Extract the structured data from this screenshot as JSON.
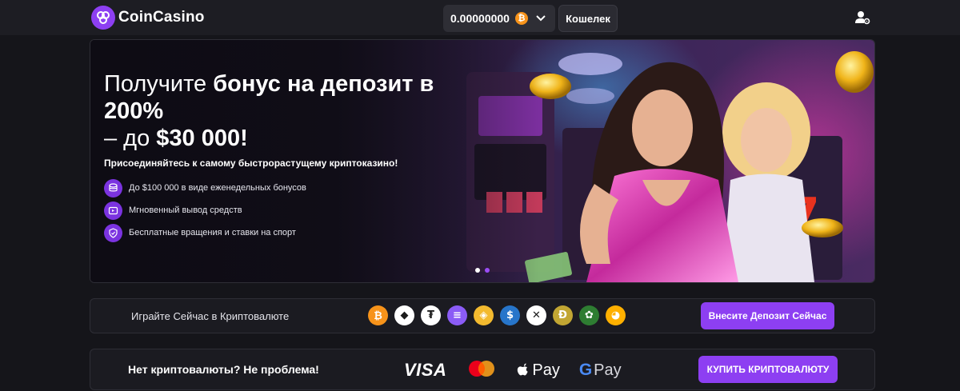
{
  "header": {
    "brand": "CoinCasino",
    "balance": "0.00000000",
    "currency_symbol": "₿",
    "wallet_label": "Кошелек"
  },
  "hero": {
    "title_plain_1": "Получите ",
    "title_bold_1": "бонус на депозит в 200%",
    "title_plain_2": "– до ",
    "title_bold_2": "$30 000!",
    "subtitle": "Присоединяйтесь к самому быстрорастущему криптоказино!",
    "features": [
      {
        "icon": "coins-icon",
        "text": "До $100 000 в виде еженедельных бонусов"
      },
      {
        "icon": "instant-withdraw-icon",
        "text": "Мгновенный вывод средств"
      },
      {
        "icon": "shield-icon",
        "text": "Бесплатные вращения и ставки на спорт"
      }
    ],
    "slides_total": 2,
    "slide_active": 2
  },
  "crypto_strip": {
    "label": "Играйте Сейчас в Криптовалюте",
    "coins": [
      {
        "name": "bitcoin-icon",
        "glyph": "₿",
        "color": "#f7931a"
      },
      {
        "name": "ethereum-icon",
        "glyph": "◆",
        "color": "#ffffff"
      },
      {
        "name": "tether-icon",
        "glyph": "₮",
        "color": "#ffffff"
      },
      {
        "name": "solana-icon",
        "glyph": "≡",
        "color": "#8b5cf6"
      },
      {
        "name": "bnb-icon",
        "glyph": "◈",
        "color": "#f3ba2f"
      },
      {
        "name": "usdc-icon",
        "glyph": "$",
        "color": "#2775ca"
      },
      {
        "name": "xrp-icon",
        "glyph": "✕",
        "color": "#ffffff"
      },
      {
        "name": "dogecoin-icon",
        "glyph": "Ð",
        "color": "#c2a633"
      },
      {
        "name": "rose-token-icon",
        "glyph": "✿",
        "color": "#2e7d32"
      },
      {
        "name": "shiba-inu-icon",
        "glyph": "◕",
        "color": "#ffb000"
      }
    ],
    "button_label": "Внесите Депозит Сейчас"
  },
  "buy_strip": {
    "label": "Нет криптовалюты? Не проблема!",
    "visa": "VISA",
    "apple_pay": "Pay",
    "google_g": "G",
    "google_pay": "Pay",
    "button_label": "КУПИТЬ КРИПТОВАЛЮТУ"
  },
  "colors": {
    "accent": "#8d3ff2",
    "background": "#15151a",
    "panel": "#1b1b21"
  }
}
